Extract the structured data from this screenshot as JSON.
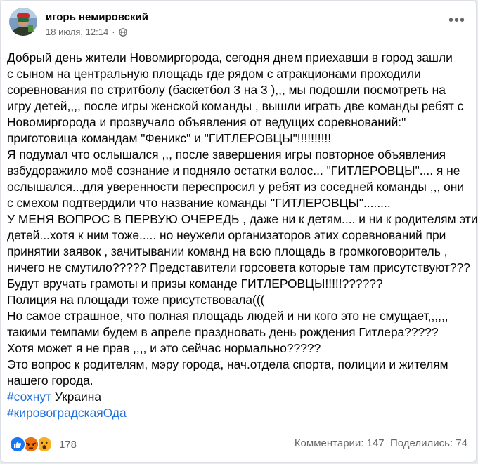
{
  "post": {
    "author": "игорь немировский",
    "date": "18 июля, 12:14",
    "separator": "·",
    "privacy_icon": "globe-icon",
    "more_icon": "more-options-icon",
    "more_label": "•••",
    "lines": [
      "Добрый день жители Новомиргорода,  сегодня днем приехавши в город зашли",
      "с сыном на центральную площадь где рядом с атракционами проходили",
      "соревнования по стритболу (баскетбол 3 на 3 ),,, мы подошли посмотреть на",
      "игру детей,,,, после игры женской команды , вышли играть две команды ребят с",
      "Новомиргорода и прозвучало объявления от ведущих соревнований:\"",
      "приготовица командам \"Феникс\" и \"ГИТЛЕРОВЦЫ\"!!!!!!!!!!",
      "Я подумал что ослышался ,,, после завершения игры повторное объявления",
      "взбудоражило моё сознание и подняло остатки волос... \"ГИТЛЕРОВЦЫ\".... я не",
      "ослышался...для уверенности переспросил у ребят из соседней команды ,,, они",
      "с смехом подтвердили что название команды \"ГИТЛЕРОВЦЫ\"........",
      "У МЕНЯ ВОПРОС В ПЕРВУЮ ОЧЕРЕДЬ , даже ни к детям.... и ни к родителям этих",
      "детей...хотя к ним тоже..... но неужели организаторов этих соревнований при",
      "принятии заявок , зачитывании команд на всю площадь в громкоговоритель ,",
      "ничего не смутило????? Представители горсовета которые там присутствуют???",
      "Будут вручать грамоты и призы команде ГИТЛЕРОВЦЫ!!!!!??????",
      "Полиция на площади тоже присутствовала(((",
      "Но самое страшное,  что полная площадь людей и ни кого это не смущает,,,,,,",
      "такими темпами будем в апреле праздновать день рождения Гитлера?????",
      "Хотя может я не прав ,,,, и это сейчас нормально?????",
      "Это вопрос к родителям, мэру города, нач.отдела спорта, полиции  и жителям",
      "нашего города."
    ],
    "hashtag1": "#сохнут",
    "hashtag1_suffix": " Украина",
    "hashtag2": "#кировоградскаяОда",
    "reactions": {
      "icons": [
        "like-icon",
        "angry-icon",
        "wow-icon"
      ],
      "count": "178"
    },
    "comments": "Комментарии: 147",
    "shares": "Поделились: 74",
    "colors": {
      "link": "#216fdb",
      "like": "#1877f2",
      "angry": "#e9710f",
      "wow": "#f7b125"
    }
  }
}
